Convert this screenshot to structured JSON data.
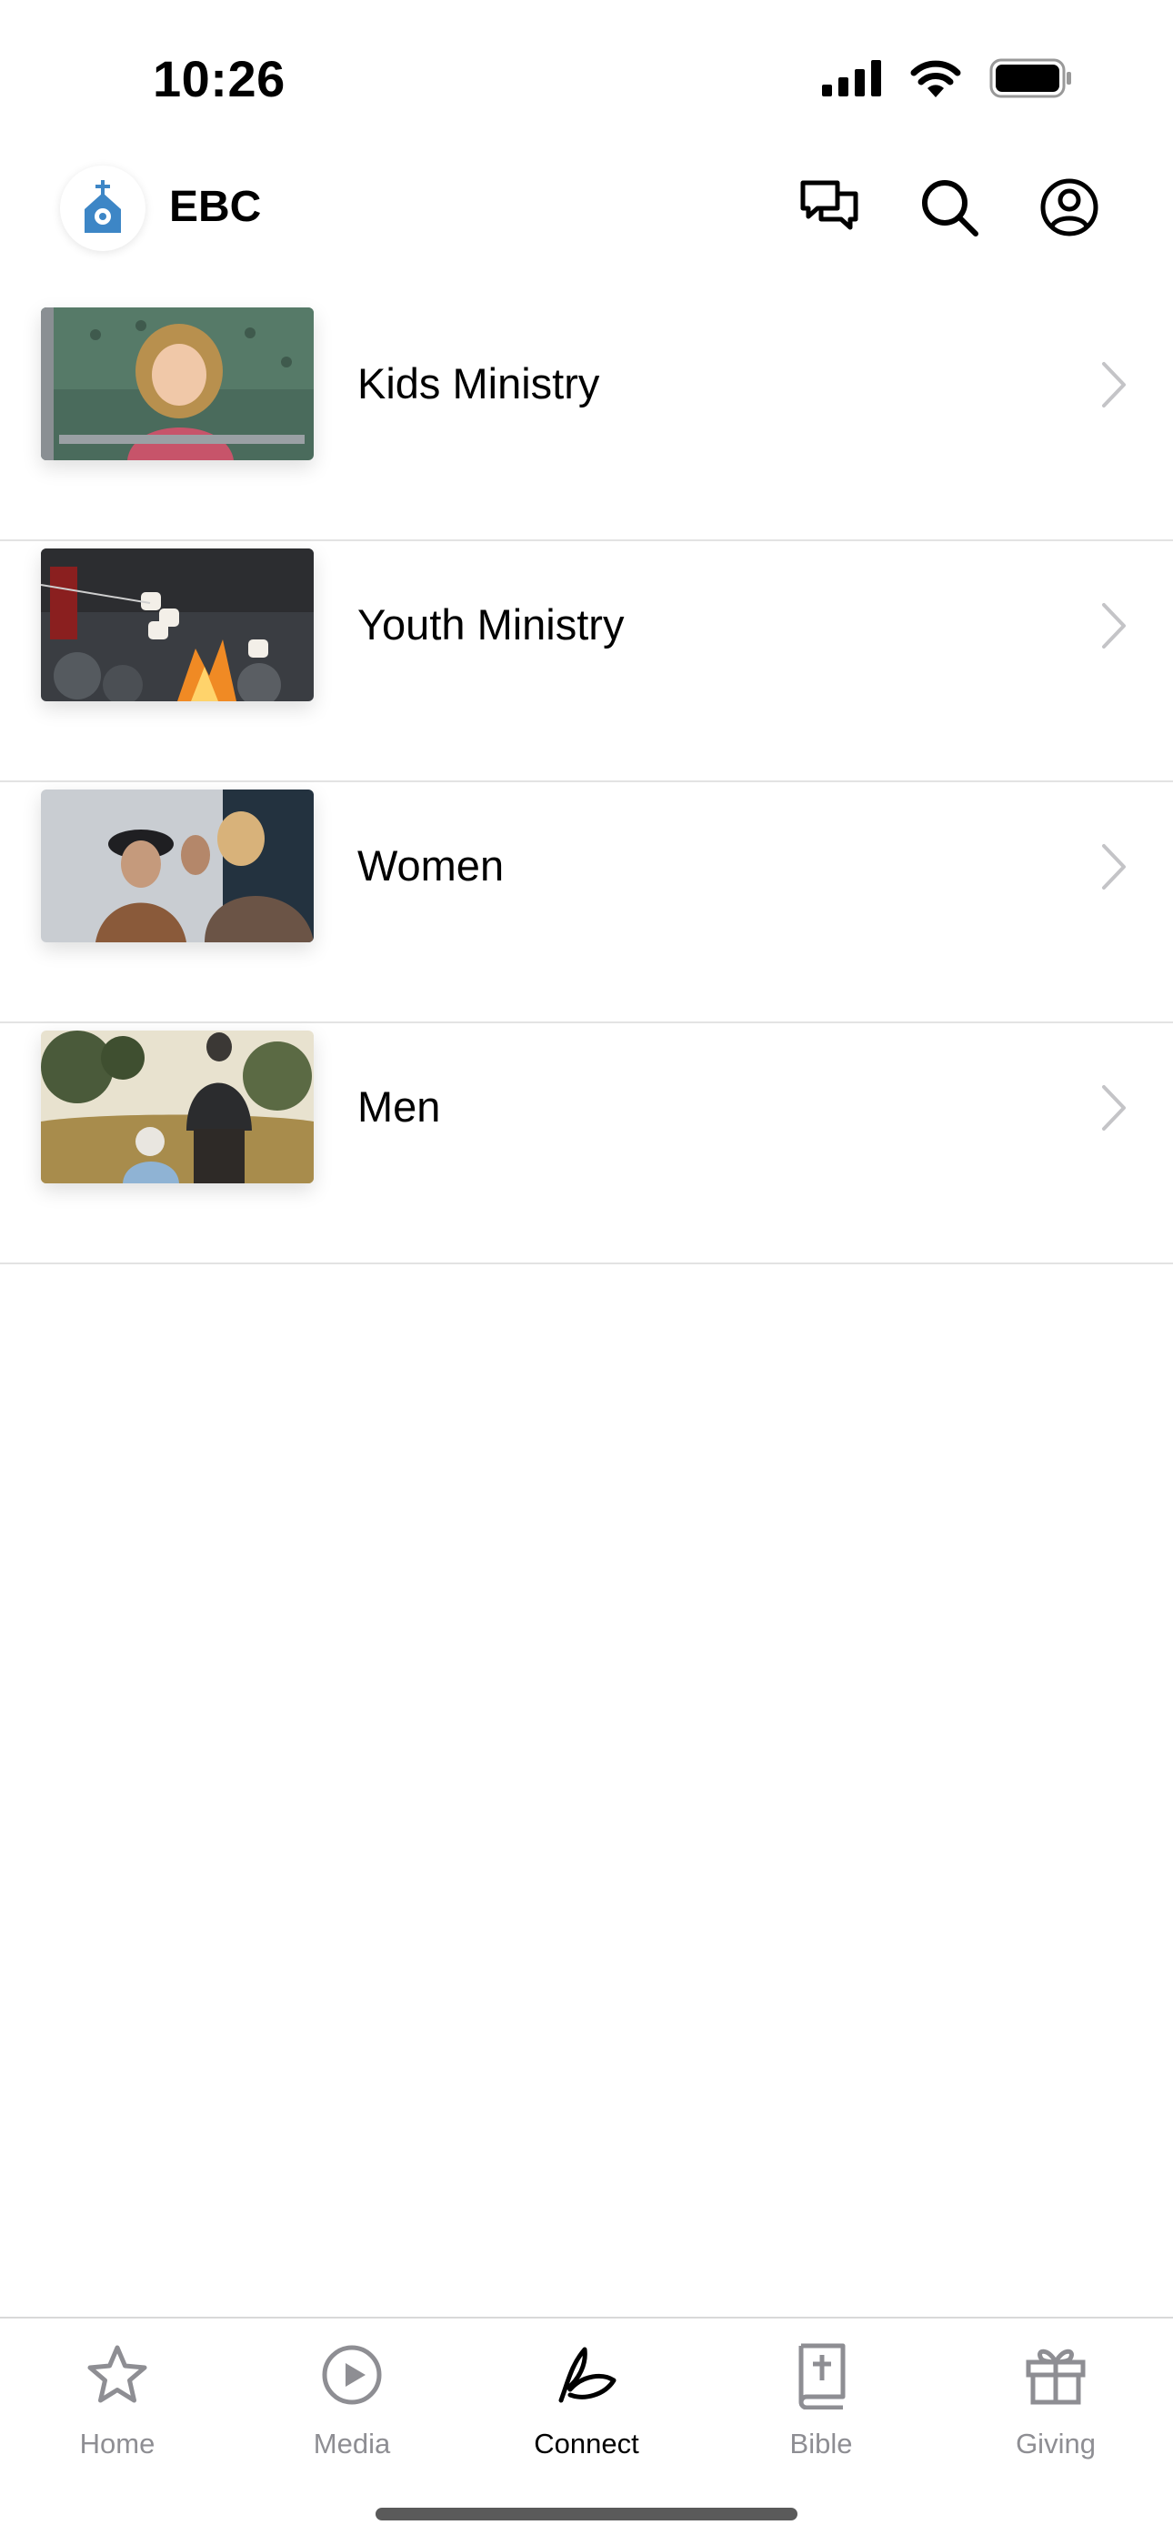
{
  "status_bar": {
    "time": "10:26"
  },
  "header": {
    "title": "EBC"
  },
  "items": [
    {
      "label": "Kids Ministry"
    },
    {
      "label": "Youth Ministry"
    },
    {
      "label": "Women"
    },
    {
      "label": "Men"
    }
  ],
  "tabs": [
    {
      "label": "Home",
      "icon": "star-icon",
      "active": false
    },
    {
      "label": "Media",
      "icon": "play-circle-icon",
      "active": false
    },
    {
      "label": "Connect",
      "icon": "leaf-icon",
      "active": true
    },
    {
      "label": "Bible",
      "icon": "bible-icon",
      "active": false
    },
    {
      "label": "Giving",
      "icon": "gift-icon",
      "active": false
    }
  ],
  "colors": {
    "accent": "#3d86c6",
    "inactive": "#8e8e93",
    "divider": "#e3e3e3"
  }
}
